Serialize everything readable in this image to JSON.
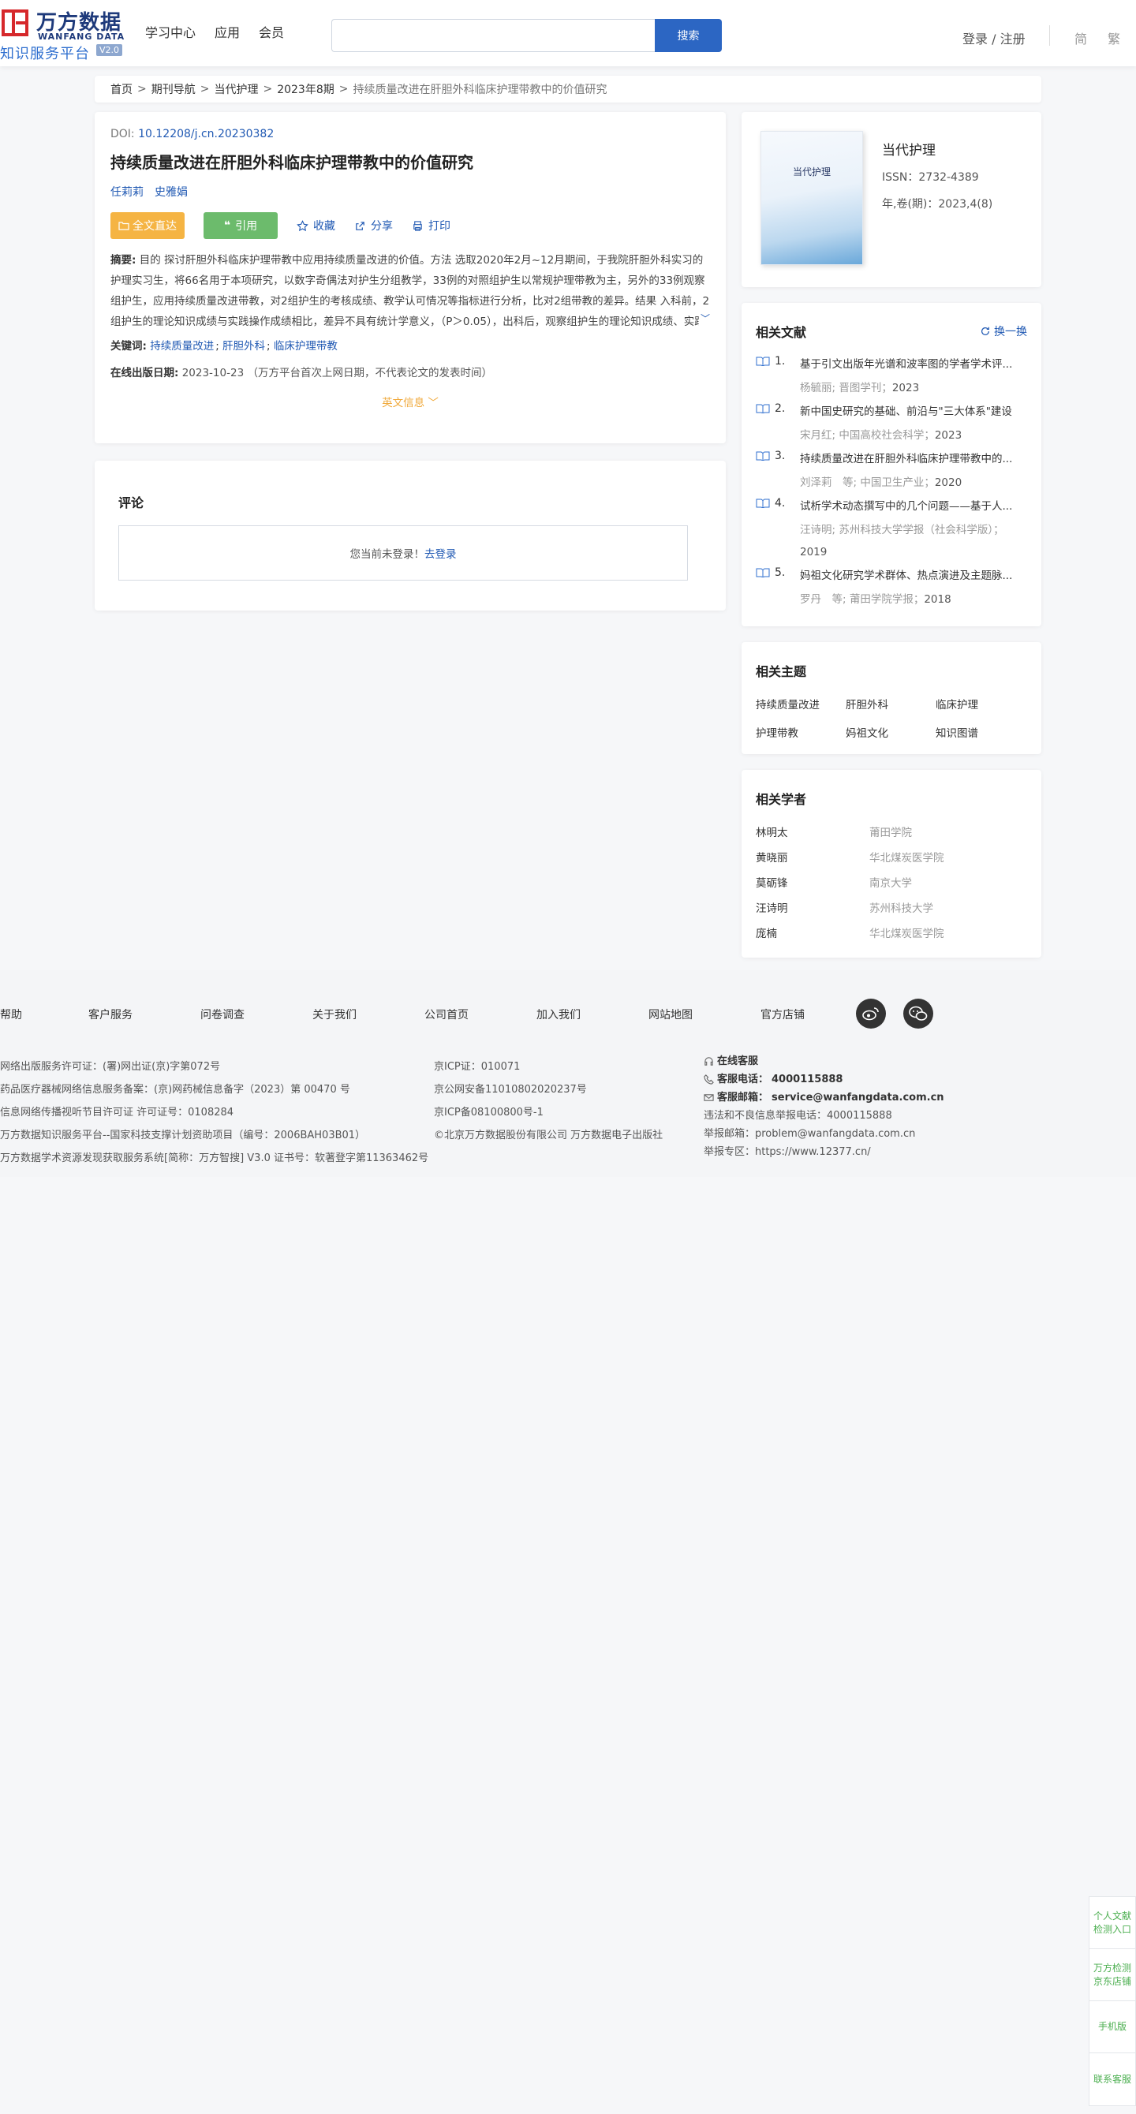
{
  "header": {
    "logo_cn": "万方数据",
    "logo_en": "WANFANG DATA",
    "logo_sub": "知识服务平台",
    "logo_ver": "V2.0",
    "nav": [
      "学习中心",
      "应用",
      "会员"
    ],
    "search_placeholder": "",
    "search_button": "搜索",
    "login": "登录 / 注册",
    "lang_simplified": "简",
    "lang_traditional": "繁"
  },
  "breadcrumb": {
    "items": [
      "首页",
      "期刊导航",
      "当代护理",
      "2023年8期"
    ],
    "separator": ">",
    "current": "持续质量改进在肝胆外科临床护理带教中的价值研究"
  },
  "article": {
    "doi_label": "DOI:",
    "doi": "10.12208/j.cn.20230382",
    "title": "持续质量改进在肝胆外科临床护理带教中的价值研究",
    "authors": [
      "任莉莉",
      "史雅娟"
    ],
    "actions": {
      "full_text": "全文直达",
      "cite": "引用",
      "favorite": "收藏",
      "share": "分享",
      "print": "打印"
    },
    "abstract_label": "摘要:",
    "abstract": "目的 探讨肝胆外科临床护理带教中应用持续质量改进的价值。方法 选取2020年2月~12月期间，于我院肝胆外科实习的护理实习生，将66名用于本项研究，以数字奇偶法对护生分组教学，33例的对照组护生以常规护理带教为主，另外的33例观察组护生，应用持续质量改进带教，对2组护生的考核成绩、教学认可情况等指标进行分析，比对2组带教的差异。结果 入科前，2组护生的理论知识成绩与实践操作成绩相比，差异不具有统计学意义，（P＞0.05），出科后，观察组护生的理论知识成绩、实践操作成绩，与对照组护生相比各项分数更优，（P＜0.05）；通过2组护生对教学的评价，明显观...",
    "keywords_label": "关键词:",
    "keywords": [
      "持续质量改进",
      "肝胆外科",
      "临床护理带教"
    ],
    "pubdate_label": "在线出版日期:",
    "pubdate": "2023-10-23",
    "pubdate_note": "（万方平台首次上网日期，不代表论文的发表时间）",
    "en_info": "英文信息"
  },
  "comment": {
    "title": "评论",
    "not_logged_in": "您当前未登录！",
    "login_link": "去登录"
  },
  "journal": {
    "cover_title": "当代护理",
    "name": "当代护理",
    "issn": "ISSN：2732-4389",
    "volume": "年,卷(期)：2023,4(8)"
  },
  "related_literature": {
    "title": "相关文献",
    "swap": "换一换",
    "items": [
      {
        "num": "1.",
        "title": "基于引文出版年光谱和波率图的学者学术评...",
        "meta": "杨毓丽; 晋图学刊；",
        "year": "2023"
      },
      {
        "num": "2.",
        "title": "新中国史研究的基础、前沿与\"三大体系\"建设",
        "meta": "宋月红; 中国高校社会科学；",
        "year": "2023"
      },
      {
        "num": "3.",
        "title": "持续质量改进在肝胆外科临床护理带教中的...",
        "meta": "刘泽莉　等; 中国卫生产业；",
        "year": "2020"
      },
      {
        "num": "4.",
        "title": "试析学术动态撰写中的几个问题——基于人...",
        "meta": "汪诗明; 苏州科技大学学报（社会科学版）；",
        "year": "2019"
      },
      {
        "num": "5.",
        "title": "妈祖文化研究学术群体、热点演进及主题脉...",
        "meta": "罗丹　等; 莆田学院学报；",
        "year": "2018"
      }
    ]
  },
  "related_topics": {
    "title": "相关主题",
    "items": [
      "持续质量改进",
      "肝胆外科",
      "临床护理",
      "护理带教",
      "妈祖文化",
      "知识图谱"
    ]
  },
  "related_scholars": {
    "title": "相关学者",
    "items": [
      {
        "name": "林明太",
        "org": "莆田学院"
      },
      {
        "name": "黄晓丽",
        "org": "华北煤炭医学院"
      },
      {
        "name": "莫砺锋",
        "org": "南京大学"
      },
      {
        "name": "汪诗明",
        "org": "苏州科技大学"
      },
      {
        "name": "庞楠",
        "org": "华北煤炭医学院"
      }
    ]
  },
  "footer": {
    "nav": [
      "帮助",
      "客户服务",
      "问卷调查",
      "关于我们",
      "公司首页",
      "加入我们",
      "网站地图",
      "官方店铺"
    ],
    "col1": [
      "网络出版服务许可证：(署)网出证(京)字第072号",
      "药品医疗器械网络信息服务备案：(京)网药械信息备字（2023）第 00470 号",
      "信息网络传播视听节目许可证 许可证号：0108284",
      "万方数据知识服务平台--国家科技支撑计划资助项目（编号：2006BAH03B01）",
      "万方数据学术资源发现获取服务系统[简称：万方智搜] V3.0 证书号：软著登字第11363462号"
    ],
    "col2": [
      "京ICP证：010071",
      "京公网安备11010802020237号",
      "京ICP备08100800号-1",
      "©北京万方数据股份有限公司 万方数据电子出版社"
    ],
    "online_service": "在线客服",
    "phone_label": "客服电话：",
    "phone": "4000115888",
    "email_label": "客服邮箱：",
    "email": "service@wanfangdata.com.cn",
    "report_phone": "违法和不良信息举报电话：4000115888",
    "report_email": "举报邮箱：problem@wanfangdata.com.cn",
    "report_site": "举报专区：https://www.12377.cn/"
  },
  "side_panel": {
    "items": [
      "个人文献检测入口",
      "万方检测京东店铺",
      "手机版",
      "联系客服"
    ]
  }
}
